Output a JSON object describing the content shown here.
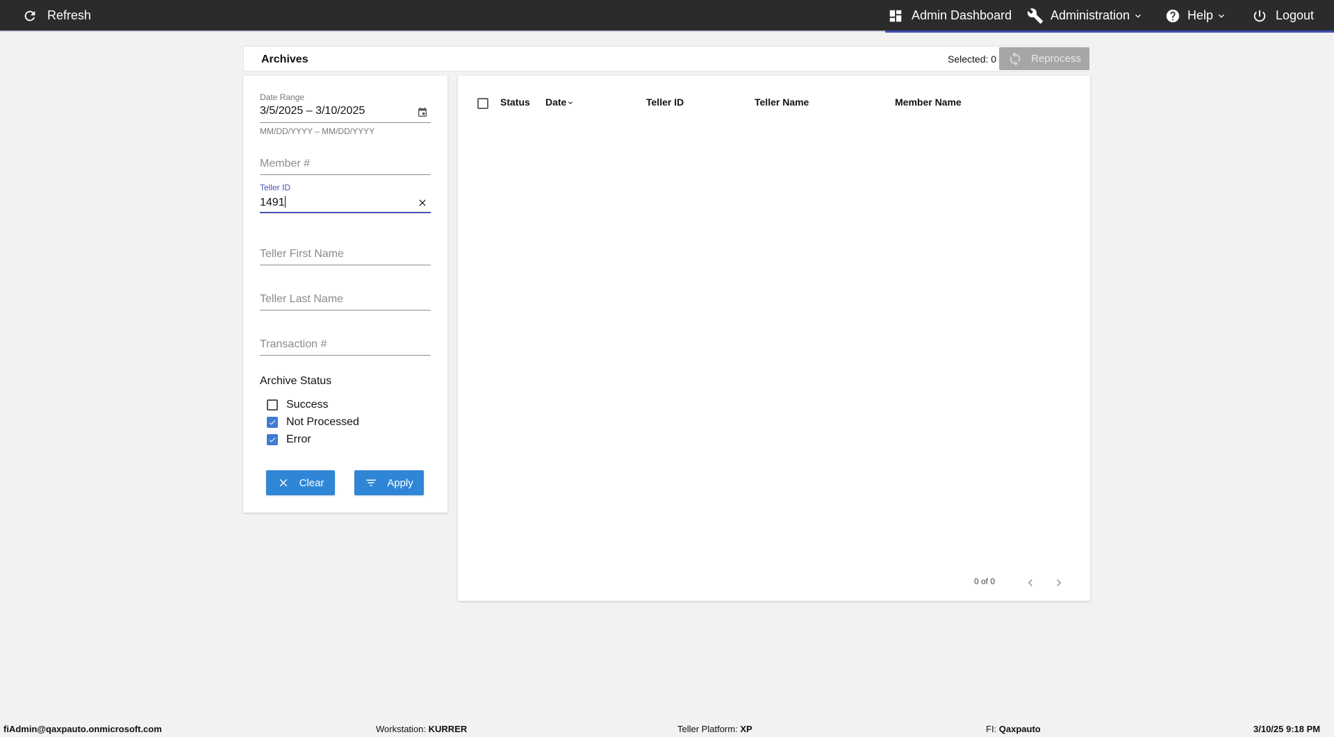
{
  "topbar": {
    "refresh_label": "Refresh",
    "admin_dashboard_label": "Admin Dashboard",
    "administration_label": "Administration",
    "help_label": "Help",
    "logout_label": "Logout"
  },
  "archives": {
    "title": "Archives",
    "selected_label": "Selected: 0",
    "reprocess_label": "Reprocess"
  },
  "filters": {
    "date_range_label": "Date Range",
    "date_range_value": "3/5/2025 – 3/10/2025",
    "date_range_hint": "MM/DD/YYYY – MM/DD/YYYY",
    "member_placeholder": "Member #",
    "teller_id_label": "Teller ID",
    "teller_id_value": "1491",
    "teller_first_name_placeholder": "Teller First Name",
    "teller_last_name_placeholder": "Teller Last Name",
    "transaction_placeholder": "Transaction #",
    "archive_status_title": "Archive Status",
    "statuses": [
      {
        "label": "Success",
        "checked": false
      },
      {
        "label": "Not Processed",
        "checked": true
      },
      {
        "label": "Error",
        "checked": true
      }
    ],
    "clear_label": "Clear",
    "apply_label": "Apply"
  },
  "table": {
    "columns": [
      "Status",
      "Date",
      "Teller ID",
      "Teller Name",
      "Member Name"
    ],
    "rows": [],
    "pager_text": "0 of 0"
  },
  "footer": {
    "user": "fiAdmin@qaxpauto.onmicrosoft.com",
    "workstation_label": "Workstation:",
    "workstation_value": "KURRER",
    "platform_label": "Teller Platform:",
    "platform_value": "XP",
    "fi_label": "FI:",
    "fi_value": "Qaxpauto",
    "datetime": "3/10/25 9:18 PM"
  },
  "colors": {
    "topbar": "#2b2b2b",
    "accent": "#3f51b5",
    "button_blue": "#2f86d6",
    "button_disabled": "#a6a6a6"
  }
}
